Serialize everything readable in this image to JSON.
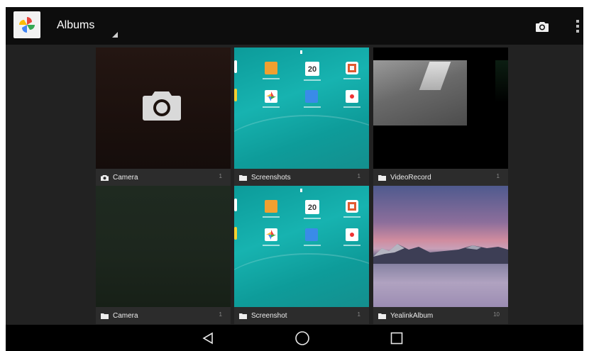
{
  "actionbar": {
    "title": "Albums",
    "app_icon": "photos-pinwheel-icon",
    "actions": [
      "camera-icon",
      "overflow-menu-icon"
    ]
  },
  "albums": [
    {
      "name": "Camera",
      "count": "1",
      "folder_icon": "camera-small-icon"
    },
    {
      "name": "Screenshots",
      "count": "1",
      "folder_icon": "folder-icon"
    },
    {
      "name": "VideoRecord",
      "count": "1",
      "folder_icon": "folder-icon"
    },
    {
      "name": "Camera",
      "count": "1",
      "folder_icon": "folder-icon"
    },
    {
      "name": "Screenshot",
      "count": "1",
      "folder_icon": "folder-icon"
    },
    {
      "name": "YealinkAlbum",
      "count": "10",
      "folder_icon": "folder-icon"
    }
  ],
  "screenshot_thumb": {
    "calendar_day": "20"
  },
  "navbar": {
    "buttons": [
      "back-icon",
      "home-icon",
      "recents-icon"
    ]
  },
  "colors": {
    "actionbar": "#0d0d0d",
    "background": "#222222",
    "label_bar": "#2c2c2c",
    "teal": "#17b3b0",
    "navbar": "#000000"
  }
}
